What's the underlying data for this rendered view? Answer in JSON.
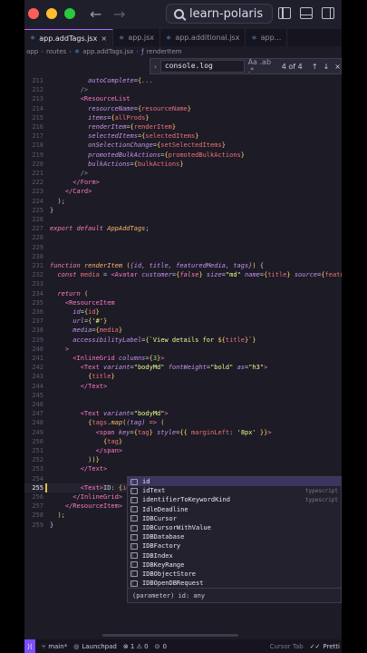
{
  "titlebar": {
    "search_text": "learn-polaris"
  },
  "tabs": [
    {
      "label": "app.addTags.jsx",
      "active": true
    },
    {
      "label": "app.jsx",
      "active": false
    },
    {
      "label": "app.additional.jsx",
      "active": false
    },
    {
      "label": "app...",
      "active": false
    }
  ],
  "breadcrumbs": [
    "app",
    "routes",
    "app.addTags.jsx",
    "renderItem"
  ],
  "find": {
    "value": "console.log",
    "options": "Aa .ab .*",
    "count": "4 of 4"
  },
  "editor": {
    "lines": [
      {
        "n": "211",
        "html": "          <span class=\"a\">autoComplete</span><span class=\"p\">=</span><span class=\"b\">{</span><span class=\"k\">...</span>"
      },
      {
        "n": "212",
        "html": "        <span class=\"c\">/></span>"
      },
      {
        "n": "213",
        "html": "        <span class=\"t\">&lt;ResourceList</span>"
      },
      {
        "n": "214",
        "html": "          <span class=\"a\">resourceName</span><span class=\"p\">=</span><span class=\"b\">{</span><span class=\"v\">resourceName</span><span class=\"b\">}</span>"
      },
      {
        "n": "215",
        "html": "          <span class=\"a\">items</span><span class=\"p\">=</span><span class=\"b\">{</span><span class=\"v\">allProds</span><span class=\"b\">}</span>"
      },
      {
        "n": "216",
        "html": "          <span class=\"a\">renderItem</span><span class=\"p\">=</span><span class=\"b\">{</span><span class=\"v\">renderItem</span><span class=\"b\">}</span>"
      },
      {
        "n": "217",
        "html": "          <span class=\"a\">selectedItems</span><span class=\"p\">=</span><span class=\"b\">{</span><span class=\"v\">selectedItems</span><span class=\"b\">}</span>"
      },
      {
        "n": "218",
        "html": "          <span class=\"a\">onSelectionChange</span><span class=\"p\">=</span><span class=\"b\">{</span><span class=\"v\">setSelectedItems</span><span class=\"b\">}</span>"
      },
      {
        "n": "219",
        "html": "          <span class=\"a\">promotedBulkActions</span><span class=\"p\">=</span><span class=\"b\">{</span><span class=\"v\">promotedBulkActions</span><span class=\"b\">}</span>"
      },
      {
        "n": "220",
        "html": "          <span class=\"a\">bulkActions</span><span class=\"p\">=</span><span class=\"b\">{</span><span class=\"v\">bulkActions</span><span class=\"b\">}</span>"
      },
      {
        "n": "221",
        "html": "        <span class=\"c\">/></span>"
      },
      {
        "n": "222",
        "html": "      <span class=\"t\">&lt;/Form&gt;</span>"
      },
      {
        "n": "223",
        "html": "    <span class=\"t\">&lt;/Card&gt;</span>"
      },
      {
        "n": "224",
        "html": "  <span class=\"p\">);</span>"
      },
      {
        "n": "225",
        "html": "<span class=\"p\">}</span>"
      },
      {
        "n": "226",
        "html": ""
      },
      {
        "n": "227",
        "html": "<span class=\"k\">export default</span> <span class=\"f\">AppAddTags</span><span class=\"p\">;</span>"
      },
      {
        "n": "228",
        "html": ""
      },
      {
        "n": "229",
        "html": ""
      },
      {
        "n": "230",
        "html": ""
      },
      {
        "n": "231",
        "html": "<span class=\"k\">function</span> <span class=\"f\">renderItem</span> <span class=\"b\">(</span><span class=\"a\">{id, title, featuredMedia, tags}</span><span class=\"b\">)</span> <span class=\"p\">{</span>"
      },
      {
        "n": "232",
        "html": "  <span class=\"k\">const</span> <span class=\"v\">media</span> <span class=\"p\">=</span> <span class=\"t\">&lt;Avatar</span> <span class=\"a\">customer</span><span class=\"p\">=</span><span class=\"b\">{</span><span class=\"k\">false</span><span class=\"b\">}</span> <span class=\"a\">size</span><span class=\"p\">=</span><span class=\"s\">\"md\"</span> <span class=\"a\">name</span><span class=\"p\">=</span><span class=\"b\">{</span><span class=\"v\">title</span><span class=\"b\">}</span> <span class=\"a\">source</span><span class=\"p\">=</span><span class=\"b\">{</span><span class=\"v\">featured</span>"
      },
      {
        "n": "233",
        "html": ""
      },
      {
        "n": "234",
        "html": "  <span class=\"k\">return</span> <span class=\"b\">(</span>"
      },
      {
        "n": "235",
        "html": "    <span class=\"t\">&lt;ResourceItem</span>"
      },
      {
        "n": "236",
        "html": "      <span class=\"a\">id</span><span class=\"p\">=</span><span class=\"b\">{</span><span class=\"v\">id</span><span class=\"b\">}</span>"
      },
      {
        "n": "237",
        "html": "      <span class=\"a\">url</span><span class=\"p\">=</span><span class=\"b\">{</span><span class=\"s\">'#'</span><span class=\"b\">}</span>"
      },
      {
        "n": "238",
        "html": "      <span class=\"a\">media</span><span class=\"p\">=</span><span class=\"b\">{</span><span class=\"v\">media</span><span class=\"b\">}</span>"
      },
      {
        "n": "239",
        "html": "      <span class=\"a\">accessibilityLabel</span><span class=\"p\">=</span><span class=\"b\">{</span><span class=\"s\">`View details for </span><span class=\"b\">${</span><span class=\"v\">title</span><span class=\"b\">}</span><span class=\"s\">`</span><span class=\"b\">}</span>"
      },
      {
        "n": "240",
        "html": "    <span class=\"t\">&gt;</span>"
      },
      {
        "n": "241",
        "html": "      <span class=\"t\">&lt;InlineGrid</span> <span class=\"a\">columns</span><span class=\"p\">=</span><span class=\"b\">{</span><span class=\"g\">3</span><span class=\"b\">}</span><span class=\"t\">&gt;</span>"
      },
      {
        "n": "242",
        "html": "        <span class=\"t\">&lt;Text</span> <span class=\"a\">variant</span><span class=\"p\">=</span><span class=\"s\">\"bodyMd\"</span> <span class=\"a\">fontWeight</span><span class=\"p\">=</span><span class=\"s\">\"bold\"</span> <span class=\"a\">as</span><span class=\"p\">=</span><span class=\"s\">\"h3\"</span><span class=\"t\">&gt;</span>"
      },
      {
        "n": "243",
        "html": "          <span class=\"b\">{</span><span class=\"v\">title</span><span class=\"b\">}</span>"
      },
      {
        "n": "244",
        "html": "        <span class=\"t\">&lt;/Text&gt;</span>"
      },
      {
        "n": "245",
        "html": ""
      },
      {
        "n": "246",
        "html": ""
      },
      {
        "n": "247",
        "html": "        <span class=\"t\">&lt;Text</span> <span class=\"a\">variant</span><span class=\"p\">=</span><span class=\"s\">\"bodyMd\"</span><span class=\"t\">&gt;</span>"
      },
      {
        "n": "248",
        "html": "          <span class=\"b\">{</span><span class=\"v\">tags</span><span class=\"p\">.</span><span class=\"f\">map</span><span class=\"b\">(</span><span class=\"a\">(tag)</span> <span class=\"k\">=&gt;</span> <span class=\"b\">(</span>"
      },
      {
        "n": "249",
        "html": "            <span class=\"t\">&lt;span</span> <span class=\"a\">key</span><span class=\"p\">=</span><span class=\"b\">{</span><span class=\"v\">tag</span><span class=\"b\">}</span> <span class=\"a\">style</span><span class=\"p\">=</span><span class=\"b\">{{</span> <span class=\"v\">marginLeft</span><span class=\"p\">:</span> <span class=\"s\">'8px'</span> <span class=\"b\">}}</span><span class=\"t\">&gt;</span>"
      },
      {
        "n": "250",
        "html": "              <span class=\"b\">{</span><span class=\"v\">tag</span><span class=\"b\">}</span>"
      },
      {
        "n": "251",
        "html": "            <span class=\"t\">&lt;/span&gt;</span>"
      },
      {
        "n": "252",
        "html": "          <span class=\"b\">))}</span>"
      },
      {
        "n": "253",
        "html": "        <span class=\"t\">&lt;/Text&gt;</span>"
      },
      {
        "n": "254",
        "html": ""
      },
      {
        "n": "255",
        "html": "        <span class=\"t\">&lt;Text&gt;</span><span class=\"p\">ID: </span><span class=\"b\">{</span><span class=\"v\">id</span><span class=\"p\">|</span><span class=\"t\">&lt;/Text&gt;</span>",
        "current": true
      },
      {
        "n": "256",
        "html": "      <span class=\"t\">&lt;/InlineGrid&gt;</span>"
      },
      {
        "n": "257",
        "html": "    <span class=\"t\">&lt;/ResourceItem&gt;</span>"
      },
      {
        "n": "258",
        "html": "  <span class=\"b\">)</span><span class=\"p\">;</span>"
      },
      {
        "n": "259",
        "html": "<span class=\"p\">}</span>"
      }
    ]
  },
  "suggestions": {
    "items": [
      {
        "label": "id",
        "source": "",
        "selected": true
      },
      {
        "label": "idText",
        "source": "typescript"
      },
      {
        "label": "identifierToKeywordKind",
        "source": "typescript"
      },
      {
        "label": "IdleDeadline",
        "source": ""
      },
      {
        "label": "IDBCursor",
        "source": ""
      },
      {
        "label": "IDBCursorWithValue",
        "source": ""
      },
      {
        "label": "IDBDatabase",
        "source": ""
      },
      {
        "label": "IDBFactory",
        "source": ""
      },
      {
        "label": "IDBIndex",
        "source": ""
      },
      {
        "label": "IDBKeyRange",
        "source": ""
      },
      {
        "label": "IDBObjectStore",
        "source": ""
      },
      {
        "label": "IDBOpenDBRequest",
        "source": ""
      }
    ],
    "description": "(parameter) id: any"
  },
  "statusbar": {
    "branch": "main*",
    "launchpad": "Launchpad",
    "problems": "⊗ 1  ⚠ 0",
    "ports": "0",
    "cursor_tab": "Cursor Tab",
    "prettier": "Pretti"
  },
  "colors": {
    "editor_bg": "#1c1b26",
    "accent": "#7c4dff",
    "tag": "#ff79c6",
    "attribute": "#c792ea",
    "string": "#f1fa8c"
  }
}
